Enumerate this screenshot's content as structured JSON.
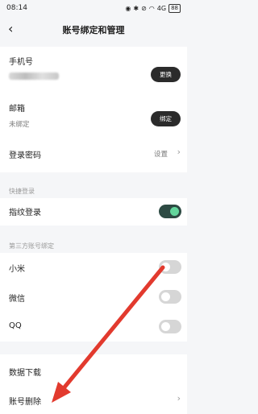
{
  "status_bar": {
    "time": "08:14",
    "network": "4G",
    "wifi_icon": "wifi-icon",
    "battery": "88"
  },
  "header": {
    "title": "账号绑定和管理"
  },
  "phone": {
    "label": "手机号",
    "action": "更换"
  },
  "email": {
    "label": "邮箱",
    "status": "未绑定",
    "action": "绑定"
  },
  "password": {
    "label": "登录密码",
    "value": "设置"
  },
  "quick_login": {
    "section": "快捷登录",
    "fingerprint_label": "指纹登录",
    "fingerprint_on": true
  },
  "third_party": {
    "section": "第三方账号绑定",
    "items": [
      {
        "label": "小米",
        "on": false
      },
      {
        "label": "微信",
        "on": false
      },
      {
        "label": "QQ",
        "on": false
      }
    ]
  },
  "data_download": {
    "label": "数据下载"
  },
  "account_delete": {
    "label": "账号删除"
  },
  "colors": {
    "accent": "#63d69c",
    "toggle_on_bg": "#2d4a43",
    "arrow": "#e23a2e"
  }
}
